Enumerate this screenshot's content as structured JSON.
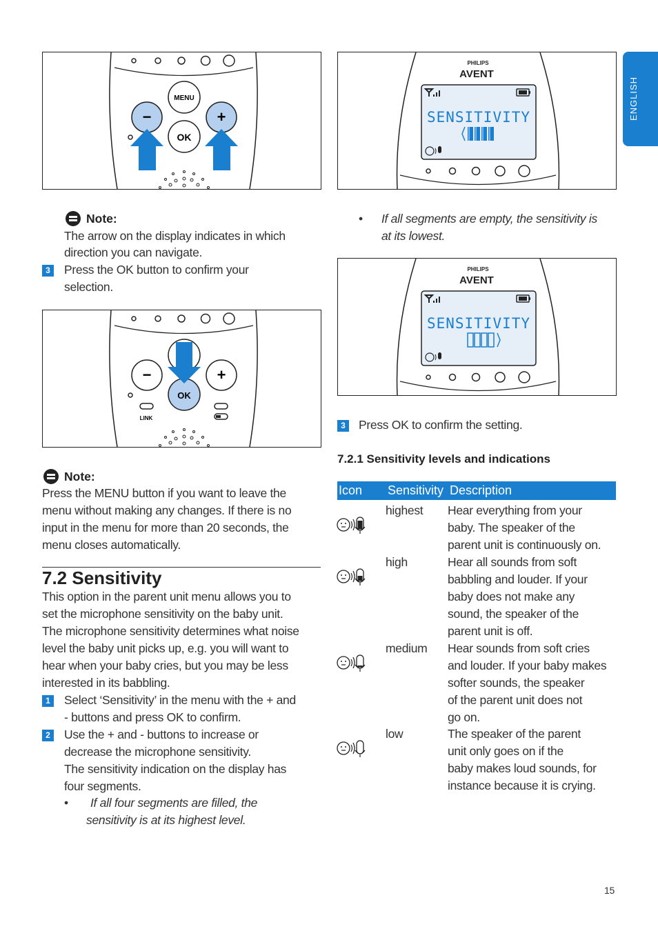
{
  "side_tab": {
    "label": "ENGLISH"
  },
  "page_number": "15",
  "figures": {
    "fig1": {
      "buttons": {
        "menu": "MENU",
        "ok": "OK",
        "minus": "−",
        "plus": "+"
      }
    },
    "fig2": {
      "buttons": {
        "ok": "OK",
        "minus": "−",
        "plus": "+",
        "link": "LINK"
      }
    },
    "display": {
      "brand_top": "PHILIPS",
      "brand": "AVENT",
      "screen_text": "SENSITIVITY"
    }
  },
  "left": {
    "note1": {
      "title": "Note:",
      "lines": [
        "The arrow on the display indicates in which",
        "direction you can navigate."
      ]
    },
    "step3": {
      "num": "3",
      "lines": [
        "Press the OK button to confirm your",
        "selection."
      ]
    },
    "note2": {
      "title": "Note:",
      "lines": [
        "Press the MENU button if you want to leave the",
        "menu without making any changes. If there is no",
        "input in the menu for more than 20 seconds, the",
        "menu closes automatically."
      ]
    },
    "section": {
      "title": "7.2  Sensitivity",
      "paragraph": [
        "This option in the parent unit menu allows you to",
        "set the microphone sensitivity on the baby unit.",
        "The microphone sensitivity determines what noise",
        "level the baby unit picks up, e.g. you will want to",
        "hear when your baby cries, but you may be less",
        "interested in its babbling."
      ],
      "steps": [
        {
          "num": "1",
          "lines": [
            "Select ‘Sensitivity’ in the menu with the + and",
            "- buttons and press OK to confirm."
          ]
        },
        {
          "num": "2",
          "lines": [
            "Use the + and - buttons to increase or",
            "decrease the microphone sensitivity.",
            "The sensitivity indication on the display has",
            "four segments."
          ]
        }
      ],
      "bullet": {
        "mark": "•",
        "lines": [
          "If all four segments are filled, the",
          "sensitivity is at its highest level."
        ]
      }
    }
  },
  "right": {
    "bullet": {
      "mark": "•",
      "lines": [
        "If all segments are empty, the sensitivity is",
        "at its lowest."
      ]
    },
    "step3": {
      "num": "3",
      "text": "Press OK to confirm the setting."
    },
    "subsection_title": "7.2.1 Sensitivity levels and indications",
    "table": {
      "header_color": "#1a7fcf",
      "headers": [
        "Icon",
        "Sensitivity",
        "Description"
      ],
      "rows": [
        {
          "icon": "mic-level-4-icon",
          "level": 4,
          "sensitivity": "highest",
          "description": [
            "Hear everything from your",
            "baby. The speaker of the",
            "parent unit is continuously on."
          ]
        },
        {
          "icon": "mic-level-3-icon",
          "level": 3,
          "sensitivity": "high",
          "description": [
            "Hear all sounds from soft",
            "babbling and louder. If your",
            "baby does not make any",
            "sound, the speaker of the",
            "parent unit is off."
          ]
        },
        {
          "icon": "mic-level-2-icon",
          "level": 2,
          "sensitivity": "medium",
          "description": [
            "Hear sounds from soft cries",
            "and louder. If your baby makes",
            "softer sounds, the speaker",
            "of the parent unit does not",
            "go on."
          ]
        },
        {
          "icon": "mic-level-1-icon",
          "level": 1,
          "sensitivity": "low",
          "description": [
            "The speaker of the parent",
            "unit only goes on if the",
            "baby makes loud sounds, for",
            "instance because it is crying."
          ]
        }
      ]
    }
  }
}
